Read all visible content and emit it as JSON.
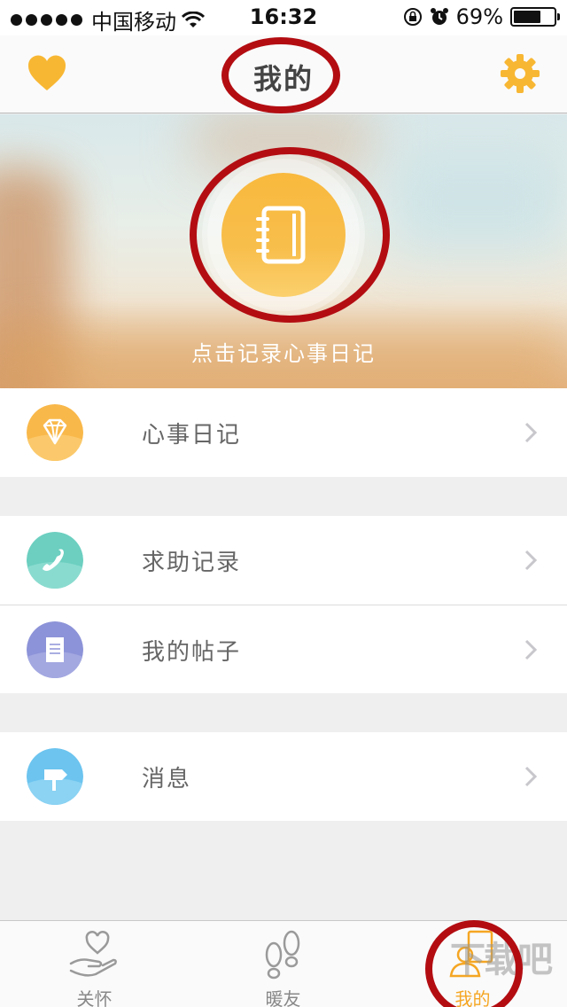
{
  "status_bar": {
    "carrier": "中国移动",
    "time": "16:32",
    "battery_percent": "69%",
    "battery_level": 0.69,
    "signal_dots": 5
  },
  "navbar": {
    "title": "我的",
    "left_icon": "heart-icon",
    "right_icon": "gear-icon",
    "accent": "#f8b733"
  },
  "banner": {
    "caption": "点击记录心事日记",
    "button_icon": "notebook-icon"
  },
  "menu": {
    "groups": [
      [
        {
          "label": "心事日记",
          "icon": "diamond-icon",
          "color": "#f9b84a"
        }
      ],
      [
        {
          "label": "求助记录",
          "icon": "phone-icon",
          "color": "#6ccfc0"
        },
        {
          "label": "我的帖子",
          "icon": "document-icon",
          "color": "#8d93d8"
        }
      ],
      [
        {
          "label": "消息",
          "icon": "signpost-icon",
          "color": "#6cc4ef"
        }
      ]
    ]
  },
  "tabbar": {
    "tabs": [
      {
        "label": "关怀",
        "icon": "hand-heart-icon",
        "active": false
      },
      {
        "label": "暖友",
        "icon": "footprints-icon",
        "active": false
      },
      {
        "label": "我的",
        "icon": "person-book-icon",
        "active": true
      }
    ]
  },
  "watermark": "下载吧"
}
